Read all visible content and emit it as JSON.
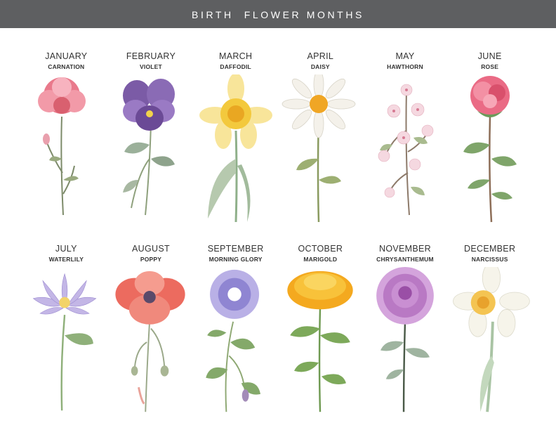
{
  "header": {
    "title": "BIRTH  FLOWER MONTHS"
  },
  "months": [
    {
      "month": "JANUARY",
      "flower": "CARNATION",
      "icon": "carnation-icon",
      "color": "#e9798b"
    },
    {
      "month": "FEBRUARY",
      "flower": "VIOLET",
      "icon": "violet-icon",
      "color": "#7b5ba6"
    },
    {
      "month": "MARCH",
      "flower": "DAFFODIL",
      "icon": "daffodil-icon",
      "color": "#f3c93d"
    },
    {
      "month": "APRIL",
      "flower": "DAISY",
      "icon": "daisy-icon",
      "color": "#f4f1ea"
    },
    {
      "month": "MAY",
      "flower": "HAWTHORN",
      "icon": "hawthorn-icon",
      "color": "#f2c7d2"
    },
    {
      "month": "JUNE",
      "flower": "ROSE",
      "icon": "rose-icon",
      "color": "#ea6b85"
    },
    {
      "month": "JULY",
      "flower": "WATERLILY",
      "icon": "waterlily-icon",
      "color": "#b9a9e0"
    },
    {
      "month": "AUGUST",
      "flower": "POPPY",
      "icon": "poppy-icon",
      "color": "#ec6b5f"
    },
    {
      "month": "SEPTEMBER",
      "flower": "MORNING GLORY",
      "icon": "morning-glory-icon",
      "color": "#a9a2de"
    },
    {
      "month": "OCTOBER",
      "flower": "MARIGOLD",
      "icon": "marigold-icon",
      "color": "#f4a91f"
    },
    {
      "month": "NOVEMBER",
      "flower": "CHRYSANTHEMUM",
      "icon": "chrysanthemum-icon",
      "color": "#b979c4"
    },
    {
      "month": "DECEMBER",
      "flower": "NARCISSUS",
      "icon": "narcissus-icon",
      "color": "#f6f4ea"
    }
  ]
}
